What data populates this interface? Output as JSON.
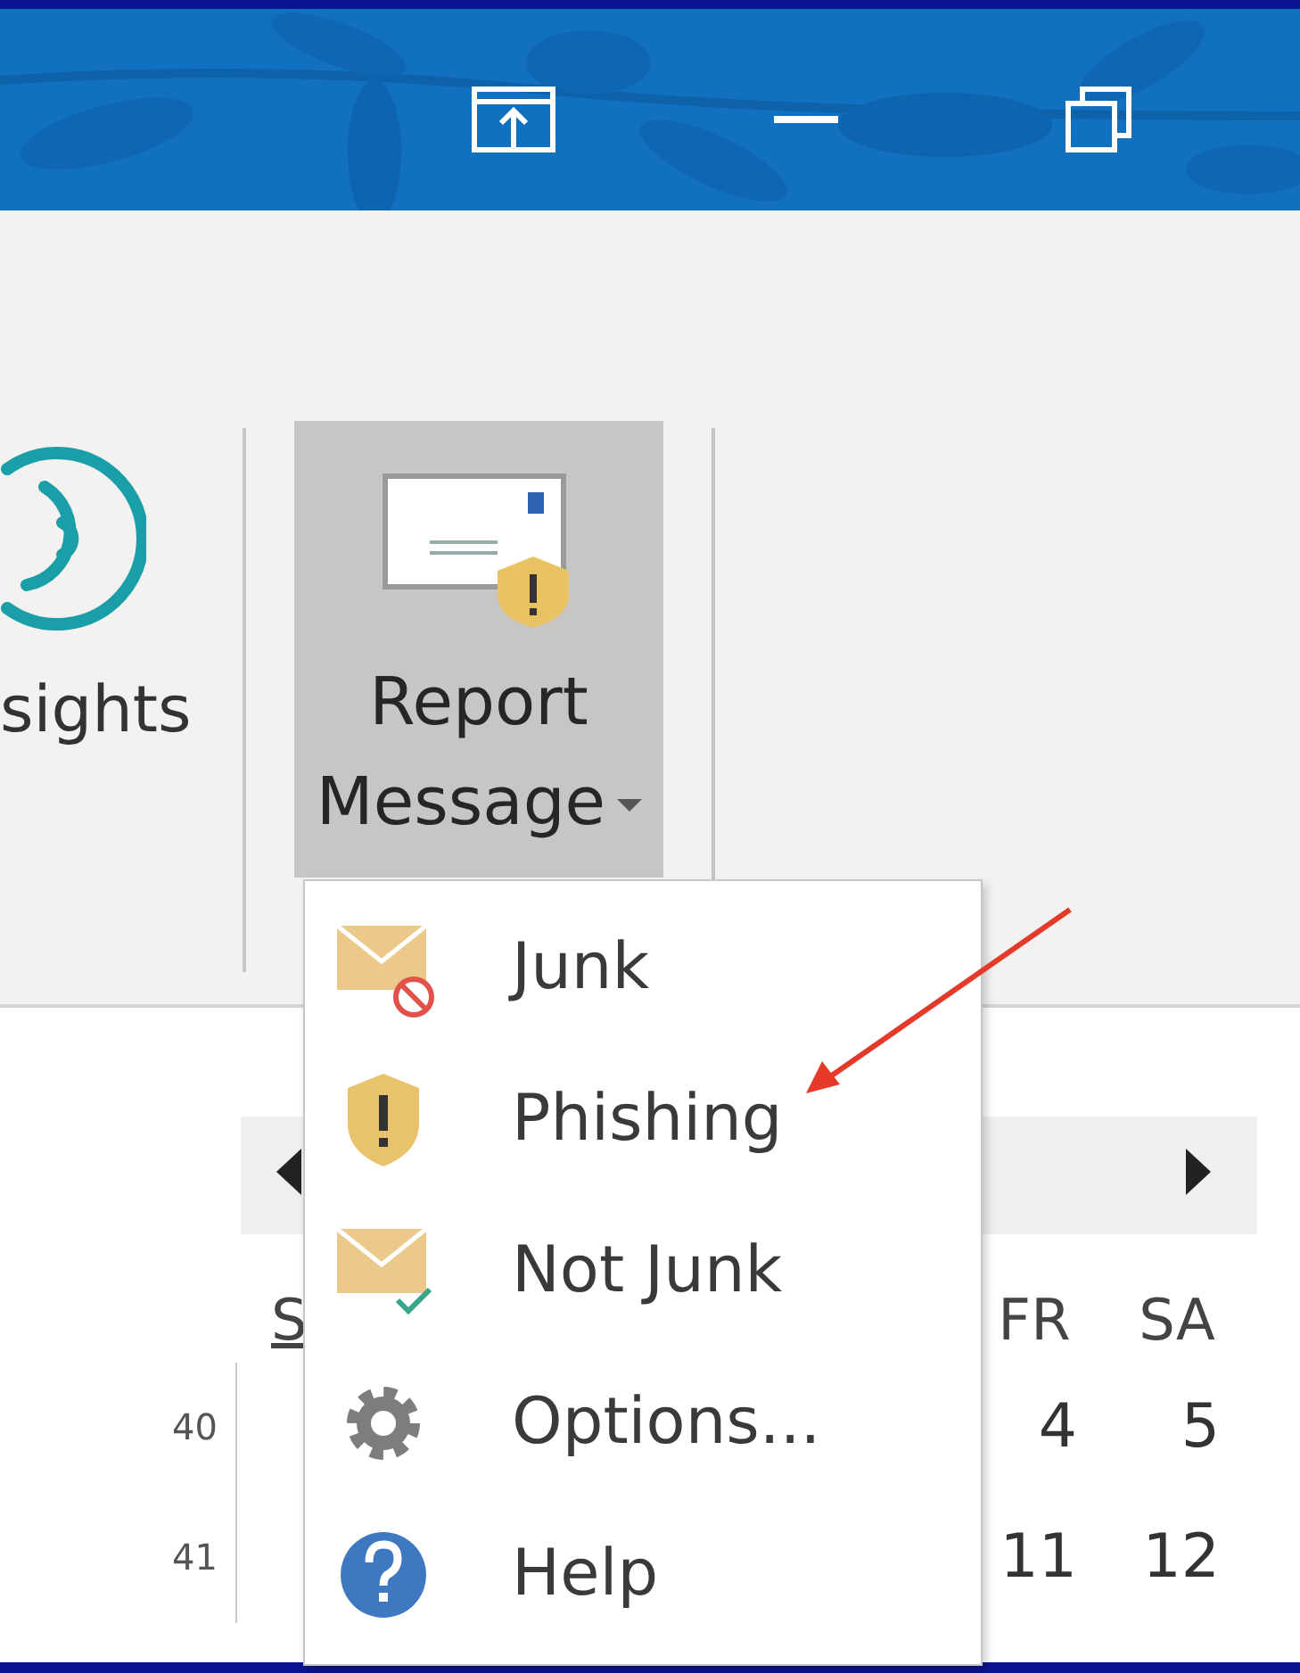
{
  "ribbon": {
    "insights_button": {
      "label": "sights"
    },
    "report_message_button": {
      "label_lines": [
        "Report",
        "Message"
      ],
      "expanded": true
    }
  },
  "report_menu": {
    "items": [
      {
        "kind": "junk",
        "label": "Junk"
      },
      {
        "kind": "phishing",
        "label": "Phishing"
      },
      {
        "kind": "not-junk",
        "label": "Not Junk"
      },
      {
        "kind": "options",
        "label": "Options..."
      },
      {
        "kind": "help",
        "label": "Help"
      }
    ]
  },
  "calendar": {
    "day_headers_left": [
      "S"
    ],
    "day_headers_right": [
      "FR",
      "SA"
    ],
    "weeks": [
      {
        "number": "40",
        "days": [
          "4",
          "5"
        ]
      },
      {
        "number": "41",
        "days": [
          "11",
          "12"
        ]
      }
    ]
  }
}
